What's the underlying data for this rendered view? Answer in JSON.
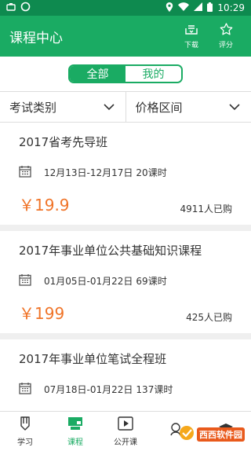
{
  "status": {
    "time": "10:29"
  },
  "header": {
    "title": "课程中心",
    "download_label": "下载",
    "rate_label": "评分"
  },
  "segment": {
    "all_label": "全部",
    "mine_label": "我的"
  },
  "filters": {
    "category_label": "考试类别",
    "price_label": "价格区间"
  },
  "courses": [
    {
      "title": "2017省考先导班",
      "dates": "12月13日-12月17日",
      "hours": "20课时",
      "price": "￥19.9",
      "buyers": "4911人已购"
    },
    {
      "title": "2017年事业单位公共基础知识课程",
      "dates": "01月05日-01月22日",
      "hours": "69课时",
      "price": "￥199",
      "buyers": "425人已购"
    },
    {
      "title": "2017年事业单位笔试全程班",
      "dates": "07月18日-01月22日",
      "hours": "137课时",
      "price": "",
      "buyers": ""
    }
  ],
  "tabs": {
    "study": "学习",
    "course": "课程",
    "public": "公开课"
  },
  "watermark": {
    "text": "西西软件园"
  },
  "colors": {
    "primary": "#1aab63",
    "statusbar": "#0e8a4f",
    "price": "#f07428"
  }
}
